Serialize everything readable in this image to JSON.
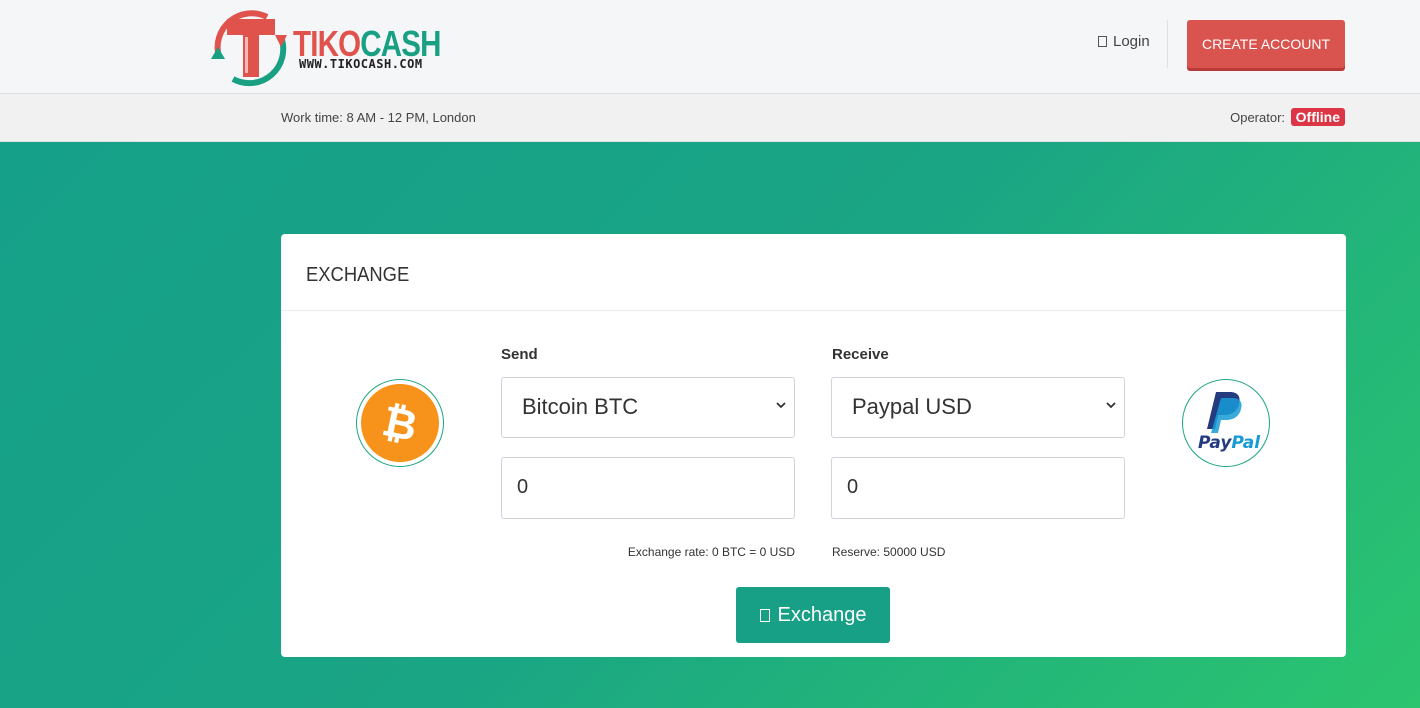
{
  "header": {
    "logo_text_1": "TIKO",
    "logo_text_2": "CASH",
    "logo_url": "WWW.TIKOCASH.COM",
    "login_label": "Login",
    "create_account_label": "CREATE ACCOUNT"
  },
  "infobar": {
    "work_time": "Work time: 8 AM - 12 PM, London",
    "operator_label": "Operator:",
    "operator_status": "Offline"
  },
  "exchange": {
    "title": "EXCHANGE",
    "send_label": "Send",
    "receive_label": "Receive",
    "send_currency": "Bitcoin BTC",
    "receive_currency": "Paypal USD",
    "send_amount": "0",
    "receive_amount": "0",
    "rate_text": "Exchange rate: 0 BTC = 0 USD",
    "reserve_text": "Reserve: 50000 USD",
    "button_label": "Exchange",
    "bitcoin_symbol": "₿",
    "paypal_text_1": "Pay",
    "paypal_text_2": "Pal"
  },
  "colors": {
    "brand_red": "#e0534c",
    "brand_green": "#19a083",
    "bitcoin_orange": "#f7931a",
    "paypal_dark": "#253b80",
    "paypal_light": "#179bd7"
  }
}
